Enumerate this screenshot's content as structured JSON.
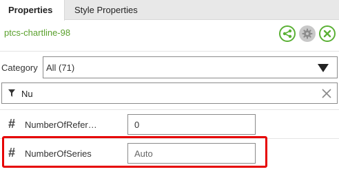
{
  "tabs": [
    {
      "label": "Properties",
      "active": true
    },
    {
      "label": "Style Properties",
      "active": false
    }
  ],
  "entity": {
    "name": "ptcs-chartline-98"
  },
  "header_buttons": {
    "share_icon": "share-icon",
    "gear_icon": "gear-icon",
    "close_icon": "close-icon"
  },
  "category": {
    "label": "Category",
    "selected": "All (71)"
  },
  "filter": {
    "value": "Nu",
    "icon": "filter-icon",
    "clear_icon": "close-icon"
  },
  "properties": [
    {
      "name": "NumberOfRefer…",
      "value": "0",
      "placeholder": "",
      "type_icon": "#"
    },
    {
      "name": "NumberOfSeries",
      "value": "",
      "placeholder": "Auto",
      "type_icon": "#",
      "highlighted": true
    }
  ],
  "colors": {
    "accent_green": "#5aa02c",
    "highlight_red": "#e60000"
  }
}
